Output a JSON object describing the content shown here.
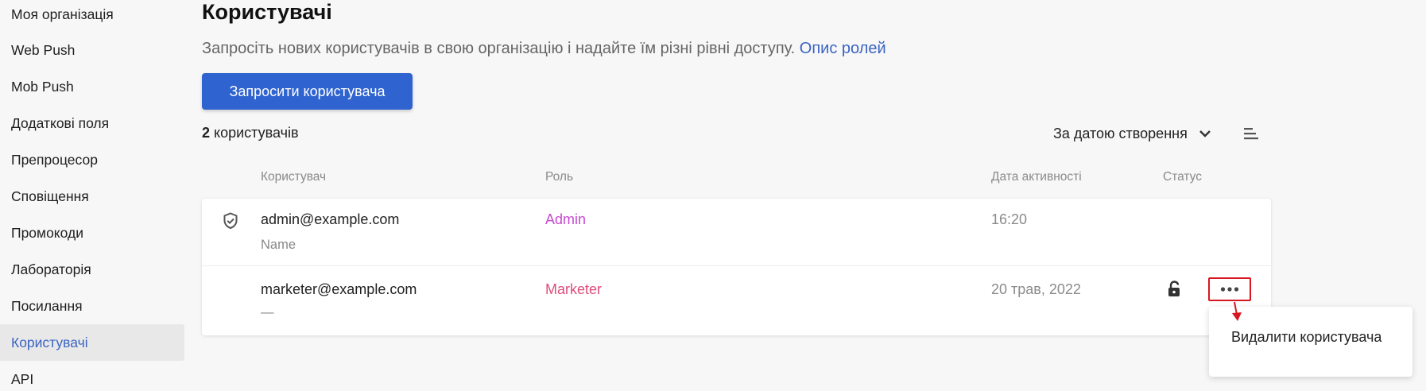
{
  "sidebar": {
    "items": [
      {
        "label": "Моя організація"
      },
      {
        "label": "Web Push"
      },
      {
        "label": "Mob Push"
      },
      {
        "label": "Додаткові поля"
      },
      {
        "label": "Препроцесор"
      },
      {
        "label": "Сповіщення"
      },
      {
        "label": "Промокоди"
      },
      {
        "label": "Лабораторія"
      },
      {
        "label": "Посилання"
      },
      {
        "label": "Користувачі",
        "active": true
      },
      {
        "label": "API"
      }
    ]
  },
  "page": {
    "title": "Користувачі",
    "subtitle": "Запросіть нових користувачів в свою організацію і надайте їм різні рівні доступу.",
    "roles_link": "Опис ролей",
    "invite_button": "Запросити користувача",
    "count_number": "2",
    "count_label": "користувачів",
    "sort_label": "За датою створення"
  },
  "table": {
    "headers": {
      "user": "Користувач",
      "role": "Роль",
      "activity": "Дата активності",
      "status": "Статус"
    },
    "rows": [
      {
        "email": "admin@example.com",
        "name": "Name",
        "role": "Admin",
        "date": "16:20",
        "icon": "shield-check-icon"
      },
      {
        "email": "marketer@example.com",
        "name": "—",
        "role": "Marketer",
        "date": "20 трав, 2022",
        "status_icon": "unlocked-padlock-icon"
      }
    ]
  },
  "popup": {
    "delete_label": "Видалити користувача"
  },
  "colors": {
    "accent": "#2f63cf",
    "link": "#3b64c2",
    "admin_role": "#c74bd1",
    "marketer_role": "#df4c7a",
    "highlight": "#d7171f"
  }
}
